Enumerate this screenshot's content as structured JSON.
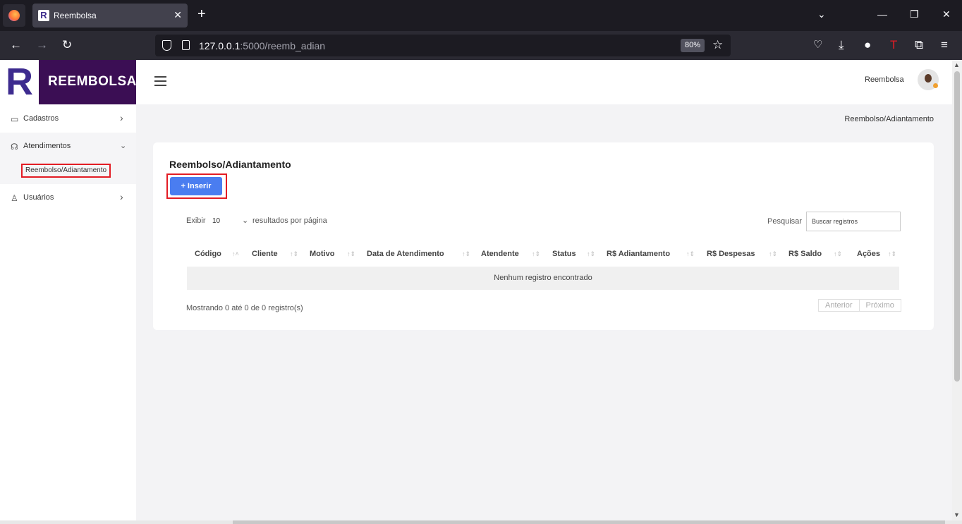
{
  "browser": {
    "tab_title": "Reembolsa",
    "tab_favicon": "R",
    "tab_close": "✕",
    "new_tab": "+",
    "url_host": "127.0.0.1",
    "url_rest": ":5000/reemb_adian",
    "zoom": "80%",
    "icons": [
      "firefox-icon",
      "back-icon",
      "forward-icon",
      "reload-icon",
      "shield-icon",
      "page-icon",
      "star-icon",
      "pocket-icon",
      "download-icon",
      "info-icon",
      "extension-t-icon",
      "extensions-icon",
      "menu-icon"
    ]
  },
  "app": {
    "brand_mark": "R",
    "brand_name": "REEMBOLSA",
    "brand_color": "#3b0e54",
    "accent_color": "#4a7df0",
    "highlight_color": "#e31c24"
  },
  "sidebar": {
    "items": [
      {
        "label": "Cadastros",
        "icon": "folder-icon",
        "expanded": false
      },
      {
        "label": "Atendimentos",
        "icon": "headset-icon",
        "expanded": true,
        "children": [
          {
            "label": "Reembolso/Adiantamento",
            "active": true
          }
        ]
      },
      {
        "label": "Usuários",
        "icon": "user-icon",
        "expanded": false
      }
    ]
  },
  "topbar": {
    "user_name": "Reembolsa"
  },
  "breadcrumb": "Reembolso/Adiantamento",
  "card": {
    "title": "Reembolso/Adiantamento",
    "insert_button": "Inserir",
    "length_label": "Exibir",
    "length_value": "10",
    "length_suffix": "resultados por página",
    "search_label": "Pesquisar",
    "search_placeholder": "Buscar registros",
    "columns": [
      "Código",
      "Cliente",
      "Motivo",
      "Data de Atendimento",
      "Atendente",
      "Status",
      "R$ Adiantamento",
      "R$ Despesas",
      "R$ Saldo",
      "Ações"
    ],
    "empty_message": "Nenhum registro encontrado",
    "info": "Mostrando 0 até 0 de 0 registro(s)",
    "pager": {
      "prev": "Anterior",
      "next": "Próximo"
    }
  }
}
